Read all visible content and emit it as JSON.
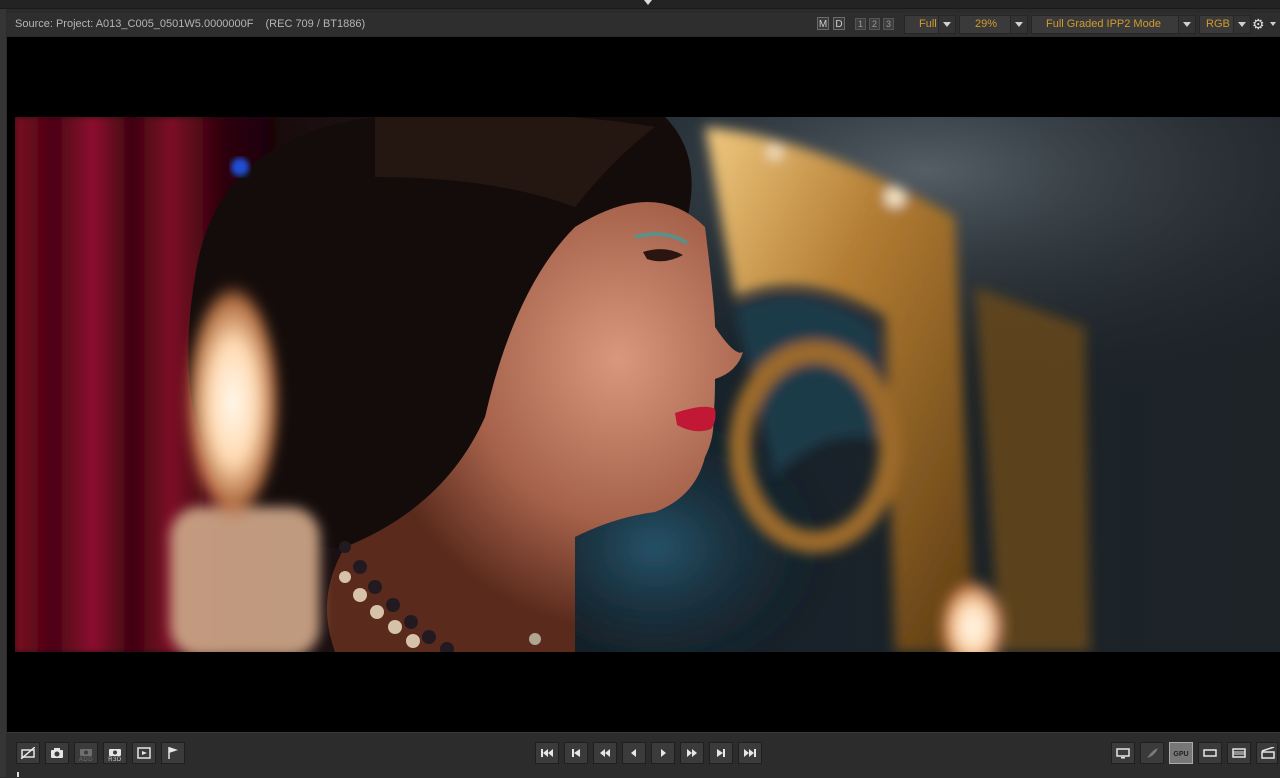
{
  "header": {
    "source_label": "Source: Project: A013_C005_0501W5.0000000F",
    "color_space": "(REC 709 / BT1886)",
    "mode_buttons": [
      "M",
      "D"
    ],
    "monitor_buttons": [
      "1",
      "2",
      "3"
    ],
    "resolution": "Full",
    "zoom": "29%",
    "decode_mode": "Full Graded IPP2 Mode",
    "channel": "RGB"
  },
  "colors": {
    "accent": "#d39a2f",
    "panel": "#2e2e2e",
    "viewer_bg": "#000000"
  },
  "left_toolbar": [
    {
      "name": "broadcast-monitor-icon"
    },
    {
      "name": "snapshot-camera-icon"
    },
    {
      "name": "camera-add-icon",
      "sub": "ADD"
    },
    {
      "name": "camera-r3d-icon",
      "sub": "R3D"
    },
    {
      "name": "export-frame-icon"
    },
    {
      "name": "flag-icon"
    }
  ],
  "transport": [
    "skip-to-start",
    "previous-clip",
    "rewind",
    "step-back",
    "play",
    "fast-forward",
    "next-clip",
    "skip-to-end"
  ],
  "right_toolbar": [
    {
      "name": "monitor-icon"
    },
    {
      "name": "rocket-icon"
    },
    {
      "name": "gpu-icon",
      "label": "GPU"
    },
    {
      "name": "widescreen-icon"
    },
    {
      "name": "filmstrip-icon"
    },
    {
      "name": "clapper-icon"
    }
  ]
}
